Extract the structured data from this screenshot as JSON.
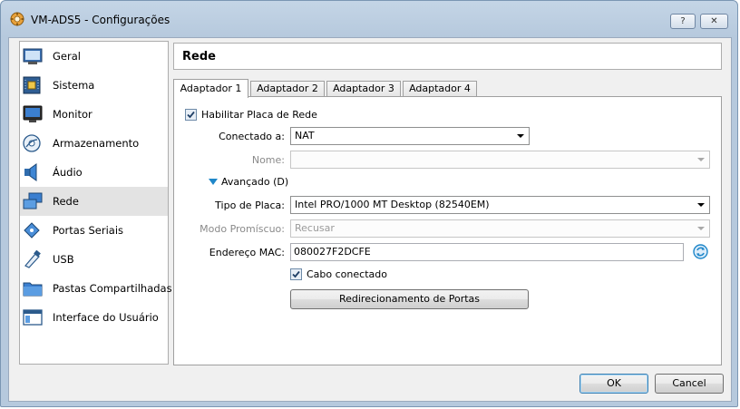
{
  "window": {
    "title": "VM-ADS5 - Configurações",
    "help_label": "?",
    "close_label": "✕"
  },
  "sidebar": {
    "items": [
      {
        "label": "Geral",
        "icon": "general-icon"
      },
      {
        "label": "Sistema",
        "icon": "system-chip-icon"
      },
      {
        "label": "Monitor",
        "icon": "monitor-icon"
      },
      {
        "label": "Armazenamento",
        "icon": "storage-icon"
      },
      {
        "label": "Áudio",
        "icon": "audio-icon"
      },
      {
        "label": "Rede",
        "icon": "network-icon",
        "selected": true
      },
      {
        "label": "Portas Seriais",
        "icon": "serial-ports-icon"
      },
      {
        "label": "USB",
        "icon": "usb-icon"
      },
      {
        "label": "Pastas Compartilhadas",
        "icon": "shared-folders-icon"
      },
      {
        "label": "Interface do Usuário",
        "icon": "user-interface-icon"
      }
    ]
  },
  "header": {
    "title": "Rede"
  },
  "tabs": [
    {
      "label": "Adaptador 1",
      "active": true
    },
    {
      "label": "Adaptador 2"
    },
    {
      "label": "Adaptador 3"
    },
    {
      "label": "Adaptador 4"
    }
  ],
  "form": {
    "enable_adapter": {
      "label": "Habilitar Placa de Rede",
      "checked": true
    },
    "attached_to": {
      "label": "Conectado a:",
      "value": "NAT"
    },
    "name": {
      "label": "Nome:",
      "value": ""
    },
    "advanced": {
      "label": "Avançado (D)",
      "expanded": true
    },
    "adapter_type": {
      "label": "Tipo de Placa:",
      "value": "Intel PRO/1000 MT Desktop (82540EM)"
    },
    "promiscuous_mode": {
      "label": "Modo Promíscuo:",
      "value": "Recusar"
    },
    "mac_address": {
      "label": "Endereço MAC:",
      "value": "080027F2DCFE"
    },
    "cable_connected": {
      "label": "Cabo conectado",
      "checked": true
    },
    "port_forwarding_label": "Redirecionamento de Portas"
  },
  "buttons": {
    "ok": "OK",
    "cancel": "Cancel"
  },
  "colors": {
    "window_frame": "#b6c9dd",
    "accent_blue": "#1f87c9",
    "selected_item": "#e3e3e3"
  }
}
